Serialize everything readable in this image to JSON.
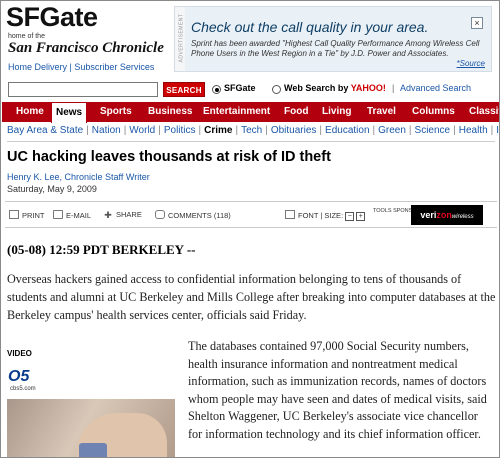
{
  "header": {
    "logo": "SFGate",
    "home_of": "home of the",
    "chronicle": "San Francisco Chronicle",
    "home_delivery": "Home Delivery",
    "link_sep": "|",
    "subscriber_services": "Subscriber Services"
  },
  "ad": {
    "vertical_label": "ADVERTISEMENT",
    "headline": "Check out the call quality in your area.",
    "body": "Sprint has been awarded \"Highest Call Quality Performance Among Wireless Cell Phone Users in the West Region in a Tie\" by J.D. Power and Associates.",
    "source": "*Source",
    "close": "×"
  },
  "search": {
    "input_value": "",
    "button": "SEARCH",
    "option_sfgate": "SFGate",
    "option_web": "Web Search by",
    "yahoo": "YAHOO!",
    "separator": "|",
    "advanced": "Advanced Search"
  },
  "nav": {
    "items": [
      "Home",
      "News",
      "Sports",
      "Business",
      "Entertainment",
      "Food",
      "Living",
      "Travel",
      "Columns",
      "Classif"
    ]
  },
  "subnav": {
    "items": [
      "Bay Area & State",
      "Nation",
      "World",
      "Politics",
      "Crime",
      "Tech",
      "Obituaries",
      "Education",
      "Green",
      "Science",
      "Health",
      "Is"
    ],
    "current": "Crime"
  },
  "article": {
    "title": "UC hacking leaves thousands at risk of ID theft",
    "author": "Henry K. Lee, Chronicle Staff Writer",
    "date": "Saturday, May 9, 2009",
    "dateline": "(05-08) 12:59 PDT BERKELEY --",
    "lead": "Overseas hackers gained access to confidential information belonging to tens of thousands of students and alumni at UC Berkeley and Mills College after breaking into computer databases at the Berkeley campus' health services center, officials said Friday.",
    "para2": "The databases contained 97,000 Social Security numbers, health insurance information and nontreatment medical information, such as immunization records, names of doctors whom people may have seen and dates of medical visits, said Shelton Waggener, UC Berkeley's associate vice chancellor for information technology and its chief information officer."
  },
  "tools": {
    "print": "PRINT",
    "email": "E-MAIL",
    "share": "SHARE",
    "comments": "COMMENTS (118)",
    "font": "FONT | SIZE:",
    "minus": "−",
    "plus": "+",
    "sponsor": "TOOLS SPONSOR:",
    "verizon_a": "veri",
    "verizon_b": "zon",
    "verizon_c": "wireless"
  },
  "video": {
    "label": "VIDEO",
    "logo": "O5",
    "logo_sub": "cbs5.com"
  }
}
